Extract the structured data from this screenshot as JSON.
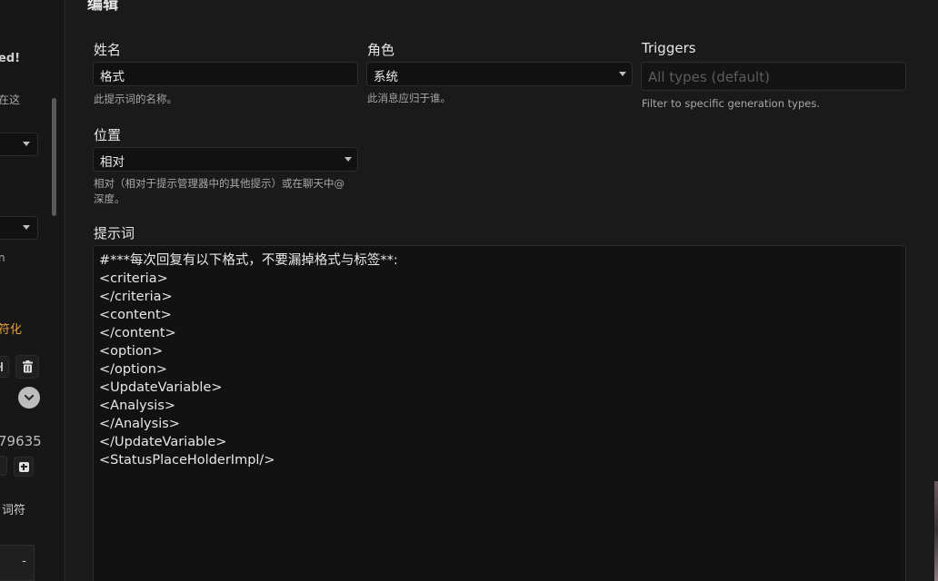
{
  "left_panel": {
    "text_ed": "ed!",
    "text_zaizhe": "在这",
    "text_n": "n",
    "text_fuhua": "符化",
    "number": "79635",
    "text_cifu": "词符",
    "box_dash": "-",
    "plus_symbol": "+"
  },
  "editor": {
    "title": "编辑",
    "name": {
      "label": "姓名",
      "value": "格式",
      "hint": "此提示词的名称。"
    },
    "role": {
      "label": "角色",
      "value": "系统",
      "hint": "此消息应归于谁。"
    },
    "triggers": {
      "label": "Triggers",
      "placeholder": "All types (default)",
      "hint": "Filter to specific generation types."
    },
    "position": {
      "label": "位置",
      "value": "相对",
      "hint_line1": "相对（相对于提示管理器中的其他提示）或在聊天中@",
      "hint_line2": "深度。"
    },
    "prompt": {
      "label": "提示词",
      "lines": [
        "#***每次回复有以下格式，不要漏掉格式与标签**:",
        "<criteria>",
        "</criteria>",
        "<content>",
        "</content>",
        "<option>",
        "</option>",
        "<UpdateVariable>",
        "<Analysis>",
        "</Analysis>",
        "</UpdateVariable>",
        "<StatusPlaceHolderImpl/>"
      ]
    }
  },
  "colors": {
    "accent_orange": "#e8a13a",
    "background": "#1a1a1a",
    "input_bg": "#111111"
  }
}
